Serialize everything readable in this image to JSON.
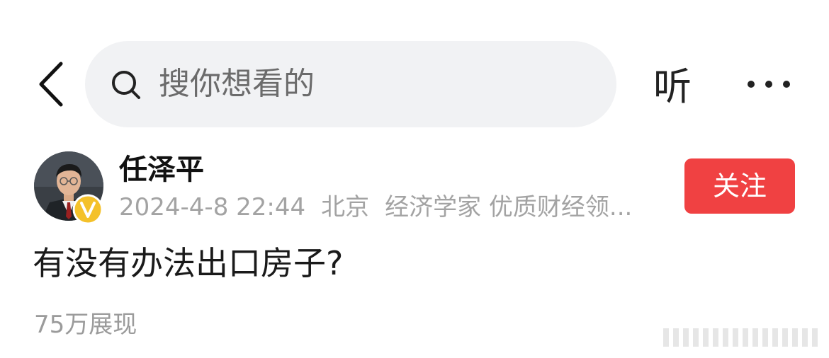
{
  "search": {
    "placeholder": "搜你想看的"
  },
  "header": {
    "listen_label": "听"
  },
  "author": {
    "name": "任泽平",
    "datetime": "2024-4-8 22:44",
    "location": "北京",
    "tags": "经济学家 优质财经领..."
  },
  "follow_label": "关注",
  "post": {
    "text": "有没有办法出口房子?",
    "impressions": "75万展现"
  },
  "colors": {
    "follow_bg": "#f04142",
    "search_bg": "#f1f2f4",
    "badge": "#f4c12a"
  }
}
